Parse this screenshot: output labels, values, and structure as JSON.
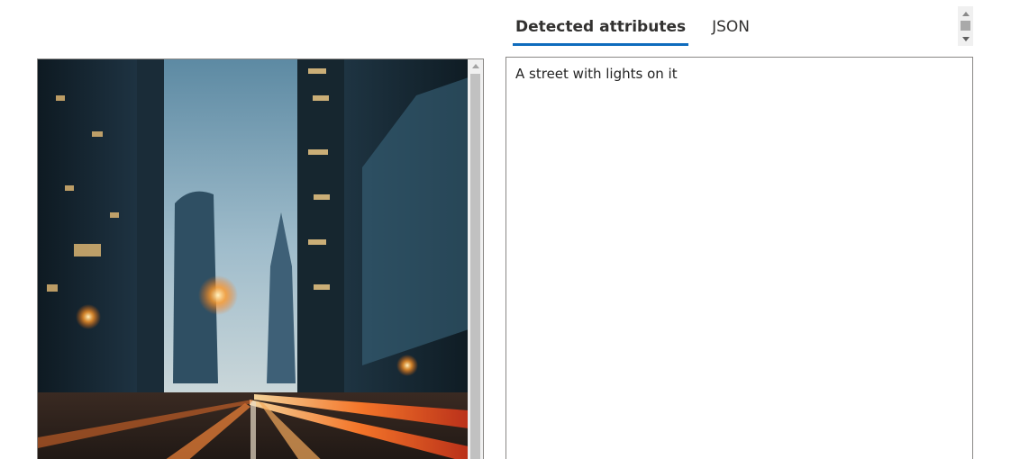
{
  "tabs": [
    {
      "label": "Detected attributes",
      "active": true
    },
    {
      "label": "JSON",
      "active": false
    }
  ],
  "result": {
    "caption": "A street with lights on it"
  },
  "image": {
    "subject": "city street at night with light trails between skyscrapers",
    "icon": "photo-preview"
  },
  "colors": {
    "tab_underline": "#0f6cbd",
    "border": "#8a8886"
  }
}
